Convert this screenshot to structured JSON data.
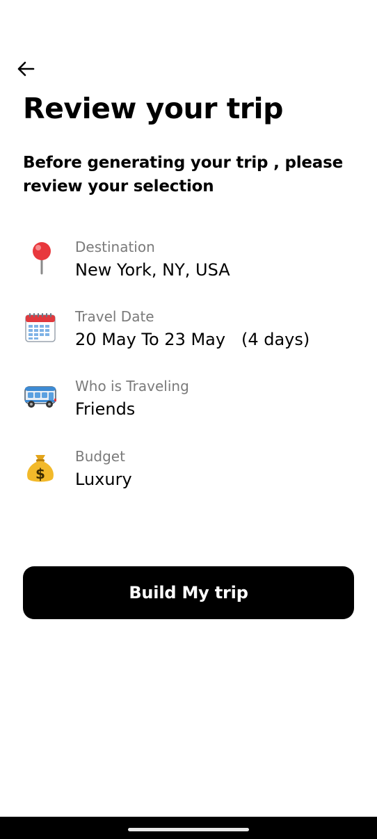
{
  "header": {
    "back_icon": "arrow-left-icon",
    "title": "Review your trip",
    "subtitle": "Before generating your trip , please review your selection"
  },
  "details": [
    {
      "icon": "round-pushpin-icon",
      "label": "Destination",
      "value": "New York, NY, USA"
    },
    {
      "icon": "calendar-icon",
      "label": "Travel Date",
      "value": "20 May To 23 May   (4 days)"
    },
    {
      "icon": "bus-icon",
      "label": "Who is Traveling",
      "value": "Friends"
    },
    {
      "icon": "money-bag-icon",
      "label": "Budget",
      "value": "Luxury"
    }
  ],
  "actions": {
    "build_label": "Build My trip"
  },
  "colors": {
    "primary": "#000000",
    "label_gray": "#7a7a7a",
    "background": "#ffffff"
  }
}
